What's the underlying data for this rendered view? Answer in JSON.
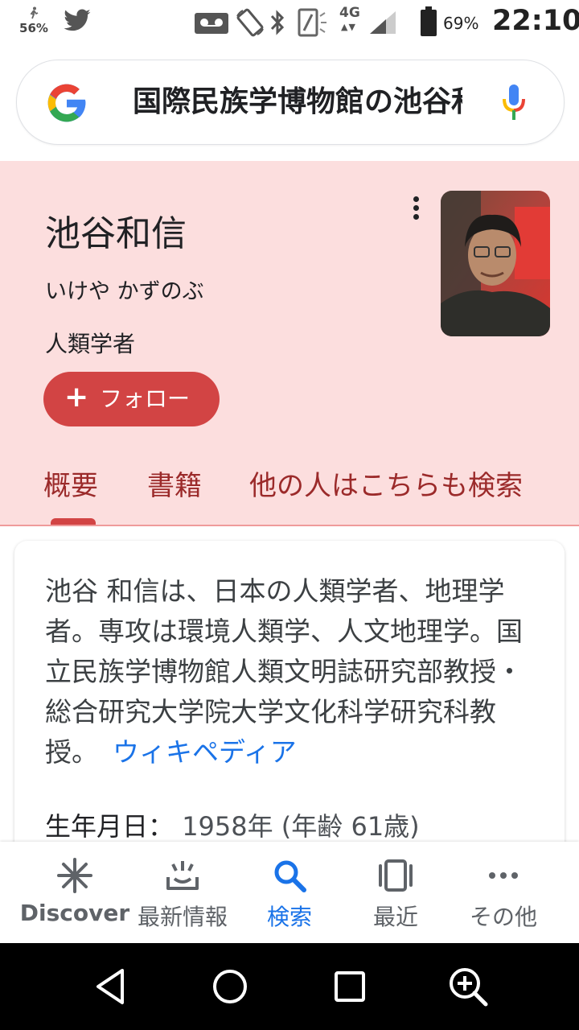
{
  "status_bar": {
    "step_percent": "56%",
    "network_type": "4G",
    "battery": "69%",
    "time": "22:10",
    "icons": [
      "runner-icon",
      "twitter-icon",
      "voicemail-icon",
      "rotate-icon",
      "bluetooth-icon",
      "nfc-icon",
      "signal-icon",
      "battery-icon"
    ]
  },
  "search": {
    "query": "国際民族学博物館の池谷和信",
    "logo": "google-g-icon",
    "mic": "mic-icon"
  },
  "knowledge_panel": {
    "title": "池谷和信",
    "reading": "いけや かずのぶ",
    "occupation": "人類学者",
    "follow_label": "フォロー",
    "tabs": [
      {
        "label": "概要",
        "active": true
      },
      {
        "label": "書籍",
        "active": false
      },
      {
        "label": "他の人はこちらも検索",
        "active": false
      }
    ],
    "accent_color": "#d24444",
    "background_color": "#fcdede"
  },
  "description": {
    "text": "池谷 和信は、日本の人類学者、地理学者。専攻は環境人類学、人文地理学。国立民族学博物館人類文明誌研究部教授・総合研究大学院大学文化科学研究科教授。",
    "source_link": "ウィキペディア",
    "birth_label": "生年月日：",
    "birth_value": "1958年 (年齢 61歳)"
  },
  "bottom_nav": {
    "items": [
      {
        "label": "Discover",
        "icon": "asterisk-icon",
        "active": false
      },
      {
        "label": "最新情報",
        "icon": "updates-tray-icon",
        "active": false
      },
      {
        "label": "検索",
        "icon": "search-icon",
        "active": true
      },
      {
        "label": "最近",
        "icon": "recent-cards-icon",
        "active": false
      },
      {
        "label": "その他",
        "icon": "more-dots-icon",
        "active": false
      }
    ]
  },
  "system_nav": [
    "back-icon",
    "home-icon",
    "overview-icon",
    "zoom-in-icon"
  ]
}
